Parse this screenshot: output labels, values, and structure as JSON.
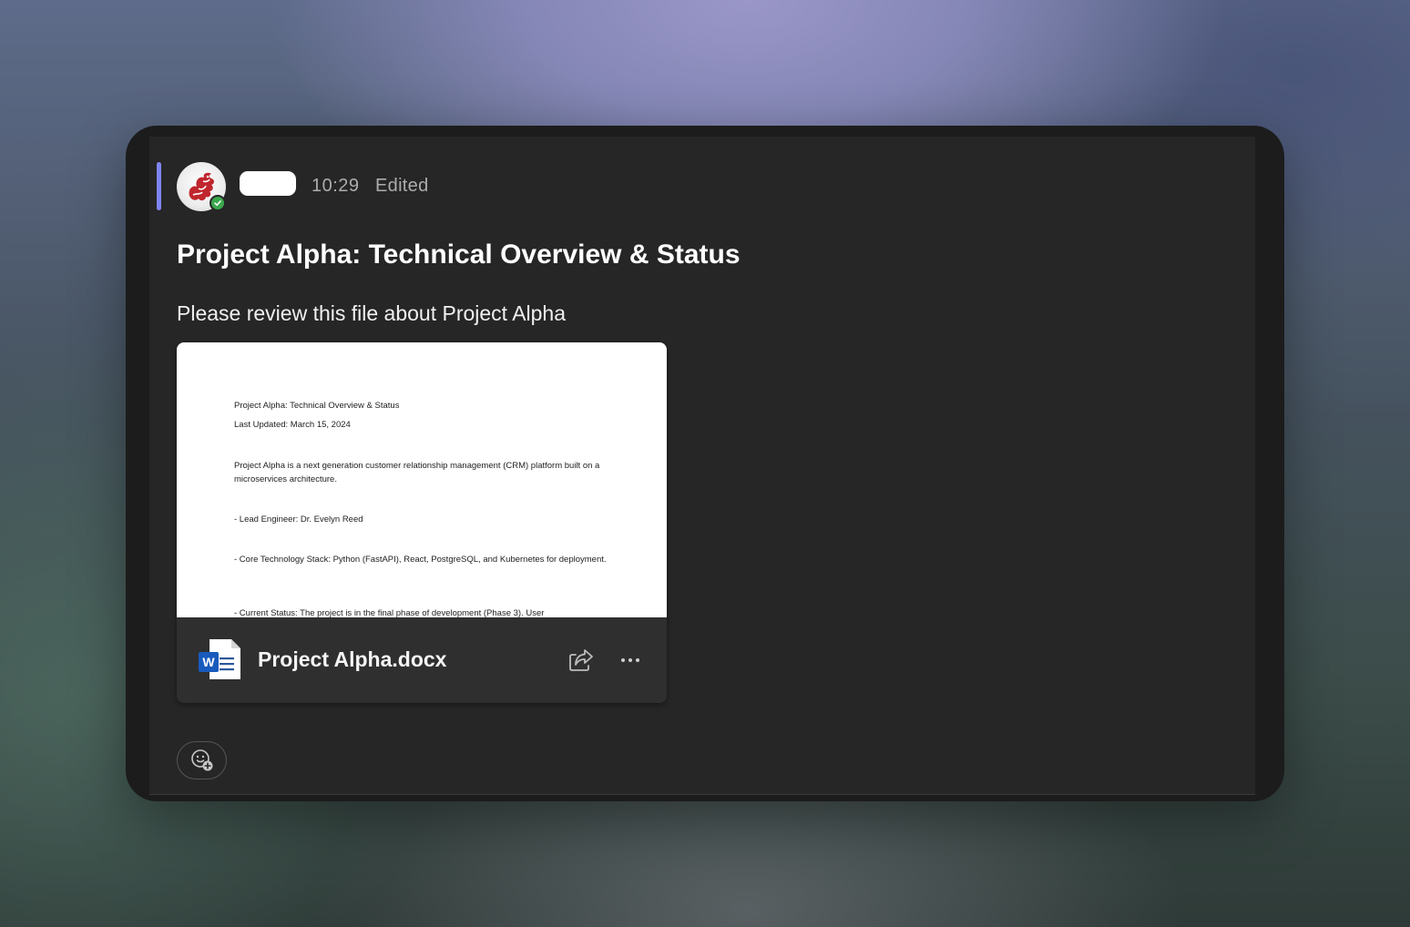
{
  "message": {
    "time": "10:29",
    "edited_label": "Edited",
    "title": "Project Alpha: Technical Overview & Status",
    "body": "Please review this file about Project Alpha",
    "accent_color": "#7f85f5"
  },
  "author": {
    "avatar_icon": "dragon-avatar",
    "presence_status": "available",
    "presence_color": "#3aa84d"
  },
  "attachment": {
    "file_name": "Project Alpha.docx",
    "file_icon": "word-document-icon",
    "preview_lines": [
      "Project Alpha: Technical Overview & Status",
      "Last Updated: March 15, 2024",
      "Project Alpha is a next generation customer relationship management (CRM) platform built on a microservices architecture.",
      "- Lead Engineer: Dr. Evelyn Reed",
      "- Core Technology Stack: Python (FastAPI), React, PostgreSQL, and Kubernetes for deployment.",
      "- Current Status: The project is in the final phase of development (Phase 3). User"
    ],
    "actions": {
      "share_icon": "share-icon",
      "more_icon": "more-options-icon"
    }
  },
  "reactions": {
    "add_reaction_icon": "add-reaction-icon"
  }
}
